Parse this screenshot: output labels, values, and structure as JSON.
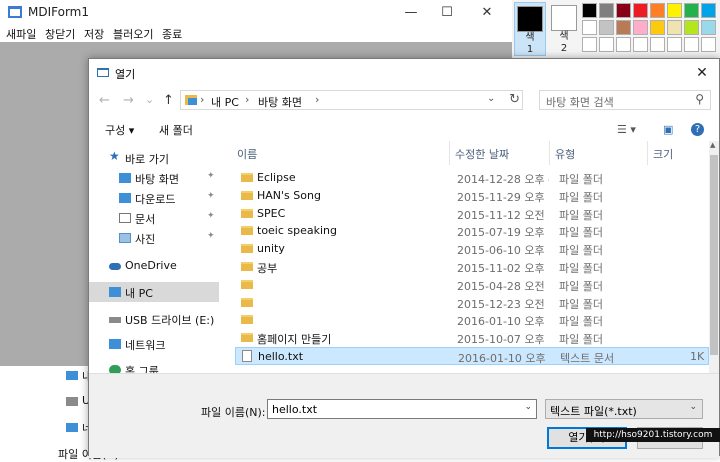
{
  "mdi_window": {
    "title": "MDIForm1",
    "min_glyph": "—",
    "max_glyph": "☐",
    "close_glyph": "✕",
    "menu": [
      "새파일",
      "창닫기",
      "저장",
      "블러오기",
      "종료"
    ]
  },
  "palette": {
    "slots": [
      {
        "label": "색\n1",
        "color": "#000000"
      },
      {
        "label": "색\n2",
        "color": "#ffffff"
      }
    ],
    "colors_row1": [
      "#000000",
      "#7f7f7f",
      "#880015",
      "#ed1c24",
      "#ff7f27",
      "#fff200",
      "#22b14c",
      "#00a2e8"
    ],
    "colors_row2": [
      "#ffffff",
      "#c3c3c3",
      "#b97a57",
      "#ffaec9",
      "#ffc90e",
      "#efe4b0",
      "#b5e61d",
      "#99d9ea"
    ]
  },
  "peek": {
    "items": [
      "내",
      "U",
      "네",
      "파일 이름(N): hello"
    ]
  },
  "dialog": {
    "title": "열기",
    "close_glyph": "✕",
    "nav": {
      "back": "←",
      "forward": "→",
      "dropdown": "⌄",
      "up": "↑"
    },
    "address": {
      "segments": [
        "내 PC",
        "바탕 화면"
      ],
      "sep": "›",
      "refresh": "↻"
    },
    "search_placeholder": "바탕 화면 검색",
    "search_glyph": "⚲",
    "toolbar": {
      "organize": "구성 ▾",
      "new_folder": "새 폴더",
      "view_glyph": "☰ ▾",
      "pane_glyph": "▣",
      "help_glyph": "?"
    },
    "nav_pane": {
      "quick_access": "바로 가기",
      "pinned": [
        "바탕 화면",
        "다운로드",
        "문서",
        "사진"
      ],
      "pin_glyph": "📌",
      "onedrive": "OneDrive",
      "this_pc": "내 PC",
      "usb": "USB 드라이브 (E:)",
      "network": "네트워크",
      "homegroup": "홈 그룹"
    },
    "columns": {
      "name": "이름",
      "date": "수정한 날짜",
      "type": "유형",
      "size": "크기",
      "sort_glyph": "⌃"
    },
    "files": [
      {
        "name": "Eclipse",
        "date": "2014-12-28 오후 4...",
        "type": "파일 폴더",
        "size": "",
        "kind": "folder"
      },
      {
        "name": "HAN's Song",
        "date": "2015-11-29 오후 7...",
        "type": "파일 폴더",
        "size": "",
        "kind": "folder"
      },
      {
        "name": "SPEC",
        "date": "2015-11-12 오전 2...",
        "type": "파일 폴더",
        "size": "",
        "kind": "folder"
      },
      {
        "name": "toeic speaking",
        "date": "2015-07-19 오후 5...",
        "type": "파일 폴더",
        "size": "",
        "kind": "folder"
      },
      {
        "name": "unity",
        "date": "2015-06-10 오후 8...",
        "type": "파일 폴더",
        "size": "",
        "kind": "folder"
      },
      {
        "name": "공부",
        "date": "2015-11-02 오후 5...",
        "type": "파일 폴더",
        "size": "",
        "kind": "folder"
      },
      {
        "name": "",
        "date": "2015-04-28 오전 1...",
        "type": "파일 폴더",
        "size": "",
        "kind": "folder"
      },
      {
        "name": "",
        "date": "2015-12-23 오전 5...",
        "type": "파일 폴더",
        "size": "",
        "kind": "folder"
      },
      {
        "name": "",
        "date": "2016-01-10 오후 1...",
        "type": "파일 폴더",
        "size": "",
        "kind": "folder"
      },
      {
        "name": "홈페이지 만들기",
        "date": "2015-10-07 오후 1...",
        "type": "파일 폴더",
        "size": "",
        "kind": "folder"
      },
      {
        "name": "hello.txt",
        "date": "2016-01-10 오후 2...",
        "type": "텍스트 문서",
        "size": "1K",
        "kind": "txt"
      }
    ],
    "filename_label": "파일 이름(N):",
    "filename_value": "hello.txt",
    "filetype_value": "텍스트 파일(*.txt)",
    "dropdown_glyph": "⌄",
    "open_label": "열기(O)",
    "watermark": "http://hso9201.tistory.com"
  }
}
